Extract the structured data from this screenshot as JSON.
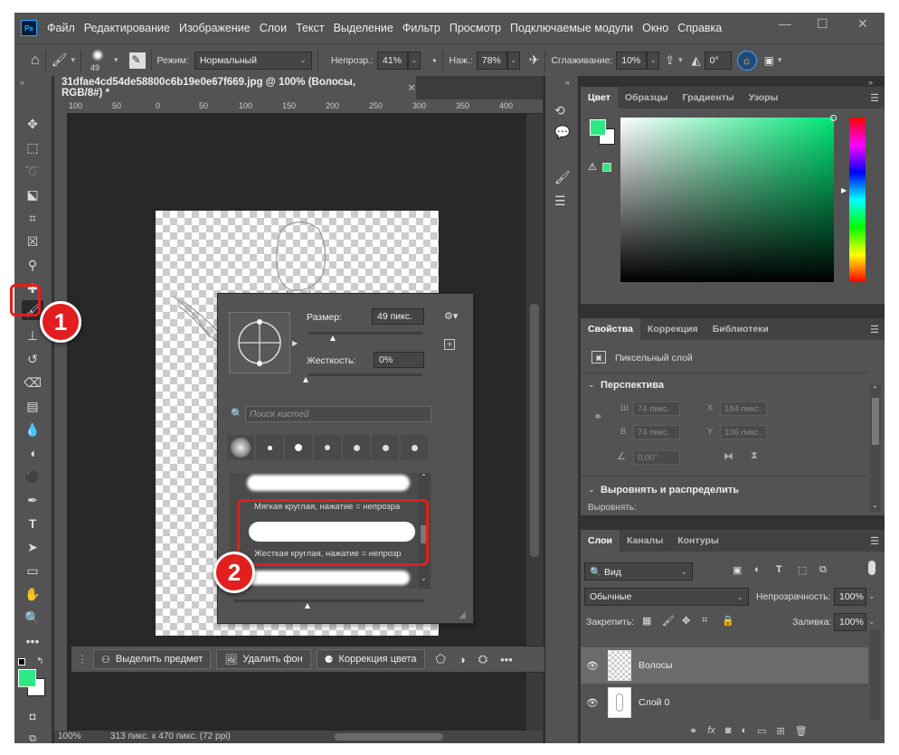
{
  "menubar": {
    "logo": "Ps",
    "items": [
      "Файл",
      "Редактирование",
      "Изображение",
      "Слои",
      "Текст",
      "Выделение",
      "Фильтр",
      "Просмотр",
      "Подключаемые модули",
      "Окно",
      "Справка"
    ]
  },
  "options": {
    "brush_size": "49",
    "mode_label": "Режим:",
    "mode_value": "Нормальный",
    "opacity_label": "Непрозр.:",
    "opacity_value": "41%",
    "flow_label": "Наж.:",
    "flow_value": "78%",
    "smoothing_label": "Сглаживание:",
    "smoothing_value": "10%",
    "angle_value": "0°"
  },
  "document": {
    "tab_title": "31dfae4cd54de58800c6b19e0e67f669.jpg @ 100% (Волосы, RGB/8#) *",
    "ruler_marks": [
      "100",
      "50",
      "0",
      "50",
      "100",
      "150",
      "200",
      "250",
      "300",
      "350",
      "400",
      "450",
      "500"
    ],
    "zoom": "100%",
    "status": "313 пикс. x 470 пикс. (72 ppi)"
  },
  "context_bar": {
    "select_subject": "Выделить предмет",
    "remove_bg": "Удалить фон",
    "color_correction": "Коррекция цвета"
  },
  "brush_popup": {
    "size_label": "Размер:",
    "size_value": "49 пикс.",
    "hardness_label": "Жесткость:",
    "hardness_value": "0%",
    "search_placeholder": "Поиск кистей",
    "preset_soft": "Мягкая круглая, нажатие = непрозра",
    "preset_hard": "Жесткая круглая, нажатие = непрозр"
  },
  "color_panel": {
    "tabs": [
      "Цвет",
      "Образцы",
      "Градиенты",
      "Узоры"
    ],
    "fg": "#2ee883",
    "bg": "#ffffff"
  },
  "properties_panel": {
    "tabs": [
      "Свойства",
      "Коррекция",
      "Библиотеки"
    ],
    "layer_type": "Пиксельный слой",
    "perspective": "Перспектива",
    "w_label": "Ш",
    "w_value": "74 пикс.",
    "h_label": "В",
    "h_value": "74 пикс.",
    "x_label": "X",
    "x_value": "184 пикс.",
    "y_label": "Y",
    "y_value": "106 пикс.",
    "angle_value": "0,00°",
    "align_title": "Выровнять и распределить",
    "align_label": "Выровнять:"
  },
  "layers_panel": {
    "tabs": [
      "Слои",
      "Каналы",
      "Контуры"
    ],
    "filter_value": "Вид",
    "blend_value": "Обычные",
    "opacity_label": "Непрозрачность:",
    "opacity_value": "100%",
    "lock_label": "Закрепить:",
    "fill_label": "Заливка:",
    "fill_value": "100%",
    "layers": [
      {
        "name": "Волосы",
        "selected": true
      },
      {
        "name": "Слой 0",
        "selected": false
      }
    ]
  },
  "annotations": {
    "badge1": "1",
    "badge2": "2"
  }
}
